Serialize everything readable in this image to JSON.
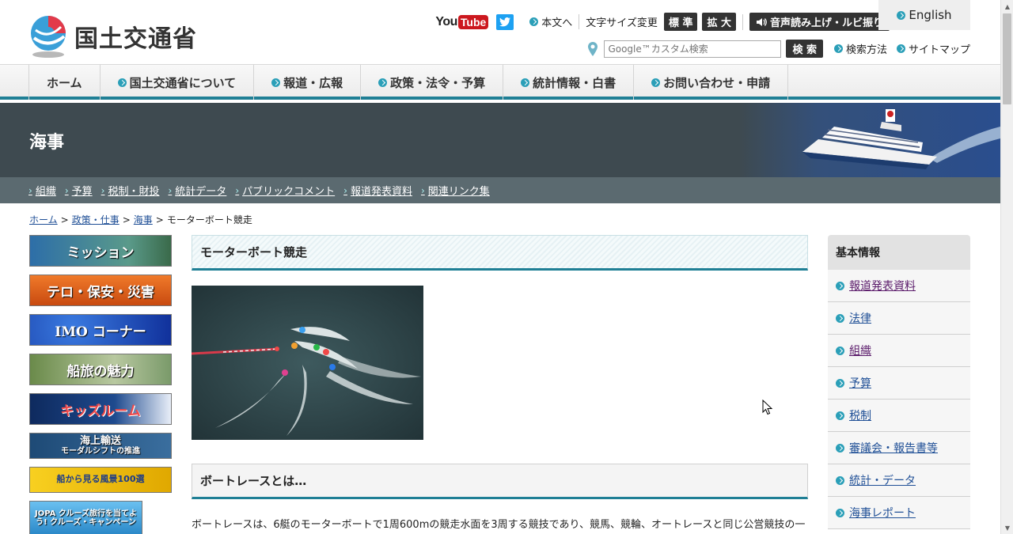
{
  "header": {
    "logo_text": "国土交通省",
    "youtube_you": "You",
    "youtube_tube": "Tube",
    "skip_link": "本文へ",
    "font_size_label": "文字サイズ変更",
    "font_standard": "標 準",
    "font_large": "拡 大",
    "voice_button": "音声読み上げ・ルビ振り",
    "english": "English",
    "search_placeholder": "Google™カスタム検索",
    "search_button": "検 索",
    "search_method": "検索方法",
    "sitemap": "サイトマップ"
  },
  "gnav": [
    "ホーム",
    "国土交通省について",
    "報道・広報",
    "政策・法令・予算",
    "統計情報・白書",
    "お問い合わせ・申請"
  ],
  "banner": {
    "title": "海事"
  },
  "subnav": [
    "組織",
    "予算",
    "税制・財投",
    "統計データ",
    "パブリックコメント",
    "報道発表資料",
    "関連リンク集"
  ],
  "breadcrumb": {
    "items": [
      "ホーム",
      "政策・仕事",
      "海事"
    ],
    "current": "モーターボート競走"
  },
  "left_banners": [
    {
      "label": "ミッション",
      "color": "#2d6ea8"
    },
    {
      "label": "テロ・保安・災害",
      "color": "#d9571a"
    },
    {
      "label": "IMO コーナー",
      "color": "#1848b0"
    },
    {
      "label": "船旅の魅力",
      "color": "#5a7a3a"
    },
    {
      "label": "キッズルーム",
      "color": "#14366e"
    },
    {
      "label": "海上輸送",
      "sub": "モーダルシフトの推進",
      "color": "#2a5a86"
    },
    {
      "label": "船から見る風景100選",
      "color": "#e8c010"
    },
    {
      "label": "JOPA クルーズ旅行を当てよう! クルーズ・キャンペーン",
      "color": "#3aa0d8"
    }
  ],
  "main": {
    "title": "モーターボート競走",
    "section_title": "ボートレースとは…",
    "paragraph": "ボートレースは、6艇のモーターボートで1周600mの競走水面を3周する競技であり、競馬、競輪、オートレースと同じ公営競技の一"
  },
  "sidebar": {
    "title": "基本情報",
    "items": [
      "報道発表資料",
      "法律",
      "組織",
      "予算",
      "税制",
      "審議会・報告書等",
      "統計・データ",
      "海事レポート"
    ]
  }
}
